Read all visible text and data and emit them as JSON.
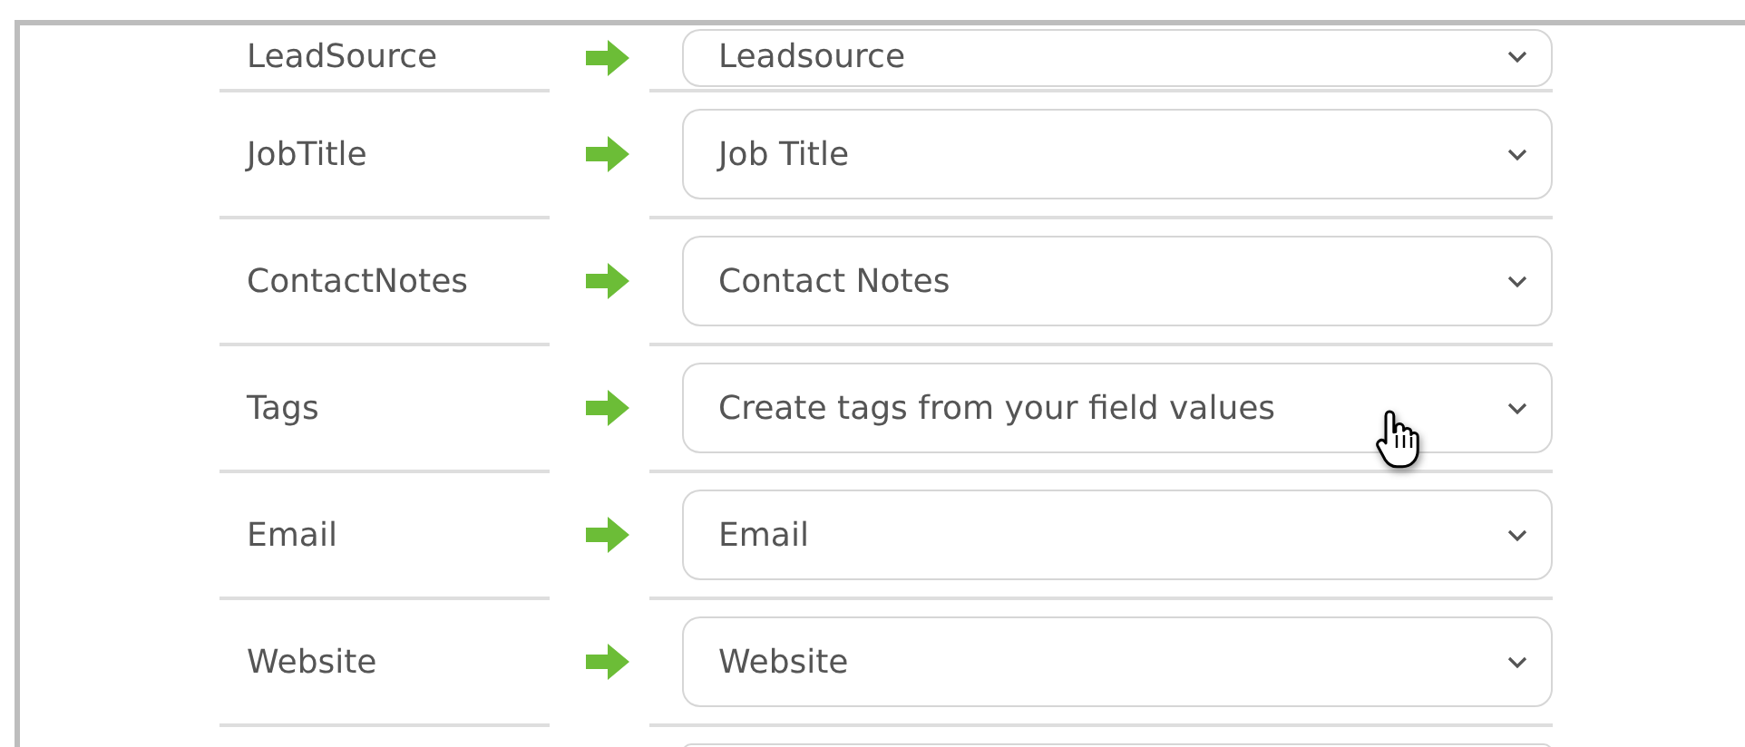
{
  "mappings": [
    {
      "field": "LeadSource",
      "target": "Leadsource"
    },
    {
      "field": "JobTitle",
      "target": "Job Title"
    },
    {
      "field": "ContactNotes",
      "target": "Contact Notes"
    },
    {
      "field": "Tags",
      "target": "Create tags from your field values"
    },
    {
      "field": "Email",
      "target": "Email"
    },
    {
      "field": "Website",
      "target": "Website"
    }
  ]
}
